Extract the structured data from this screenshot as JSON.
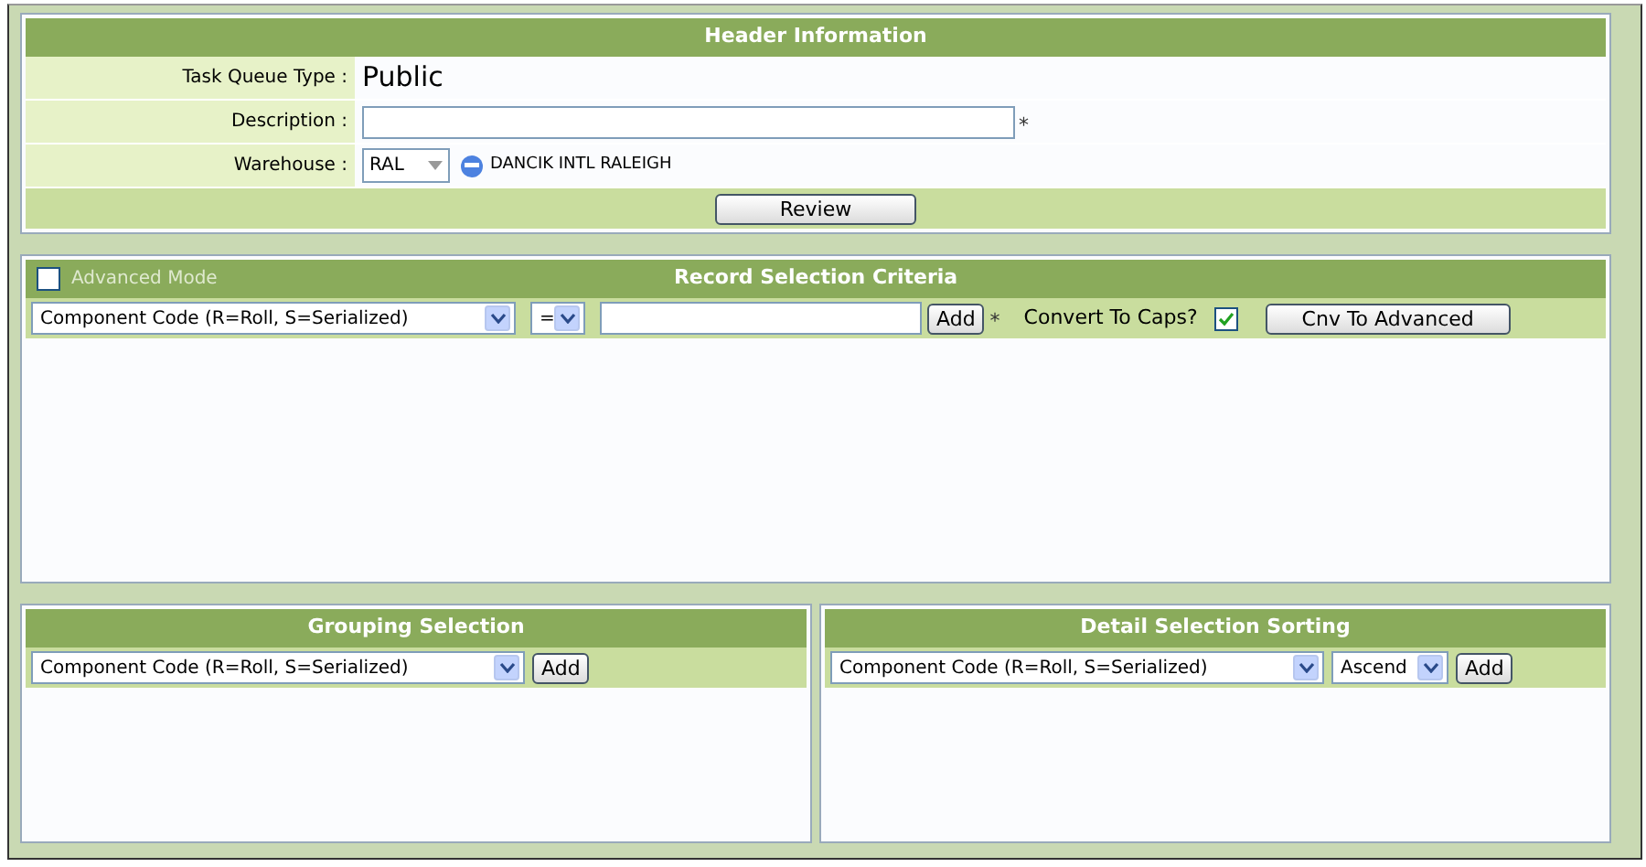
{
  "header": {
    "title": "Header Information",
    "task_queue_type": {
      "label": "Task Queue Type :",
      "value": "Public"
    },
    "description": {
      "label": "Description :",
      "required_mark": "*"
    },
    "warehouse": {
      "label": "Warehouse :",
      "value": "RAL",
      "name": "DANCIK INTL RALEIGH"
    },
    "review_button": "Review"
  },
  "record_selection": {
    "title": "Record Selection Criteria",
    "advanced_mode": {
      "label": "Advanced Mode",
      "checked": false
    },
    "field": "Component Code (R=Roll, S=Serialized)",
    "operator": "=",
    "add_button": "Add",
    "required_mark": "*",
    "convert_to_caps": {
      "label": "Convert To Caps?",
      "checked": true
    },
    "advanced_button": "Cnv To Advanced"
  },
  "grouping": {
    "title": "Grouping Selection",
    "field": "Component Code (R=Roll, S=Serialized)",
    "add_button": "Add"
  },
  "sorting": {
    "title": "Detail Selection Sorting",
    "field": "Component Code (R=Roll, S=Serialized)",
    "order": "Ascend",
    "add_button": "Add"
  }
}
